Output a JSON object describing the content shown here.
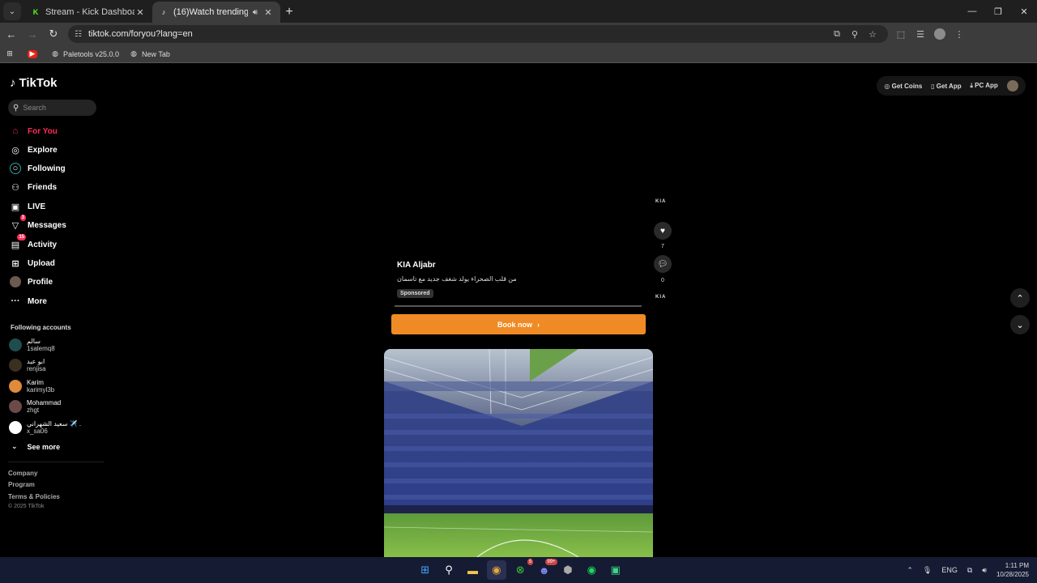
{
  "browser": {
    "tabs": [
      {
        "title": "Stream - Kick Dashboard",
        "favicon": "K",
        "favicon_color": "#53fc18",
        "active": false
      },
      {
        "title": "(16)Watch trending videos f",
        "favicon": "♪",
        "favicon_color": "#ffffff",
        "active": true
      }
    ],
    "url": "tiktok.com/foryou?lang=en",
    "bookmarks": [
      {
        "label": "",
        "icon": "youtube-icon"
      },
      {
        "label": "Paletools v25.0.0",
        "icon": "globe-icon"
      },
      {
        "label": "New Tab",
        "icon": "globe-icon"
      }
    ]
  },
  "tiktok": {
    "logo": "TikTok",
    "search_placeholder": "Search",
    "nav": [
      {
        "label": "For You",
        "icon": "home-icon",
        "glyph": "⌂",
        "active": true
      },
      {
        "label": "Explore",
        "icon": "compass-icon",
        "glyph": "◎"
      },
      {
        "label": "Following",
        "icon": "following-icon",
        "glyph": "○"
      },
      {
        "label": "Friends",
        "icon": "friends-icon",
        "glyph": "⚇"
      },
      {
        "label": "LIVE",
        "icon": "live-icon",
        "glyph": "▣"
      },
      {
        "label": "Messages",
        "icon": "messages-icon",
        "glyph": "▽",
        "badge": "3"
      },
      {
        "label": "Activity",
        "icon": "activity-icon",
        "glyph": "▤",
        "badge": "15"
      },
      {
        "label": "Upload",
        "icon": "upload-icon",
        "glyph": "⊞"
      },
      {
        "label": "Profile",
        "icon": "profile-icon",
        "glyph": ""
      },
      {
        "label": "More",
        "icon": "more-icon",
        "glyph": "···"
      }
    ],
    "following_title": "Following accounts",
    "accounts": [
      {
        "name": "سالم",
        "handle": "1salemq8",
        "color": "#1f4d4d"
      },
      {
        "name": "ابو عبد",
        "handle": "renjisa",
        "color": "#3a3020"
      },
      {
        "name": "Karim",
        "handle": "karimyl3b",
        "color": "#e08a3c"
      },
      {
        "name": "Mohammad",
        "handle": "zhgt",
        "color": "#6b4a4a"
      },
      {
        "name": "سعيد الشهراني ✈️ .",
        "handle": "x_sa06",
        "color": "#ffffff"
      }
    ],
    "see_more": "See more",
    "footer": [
      "Company",
      "Program",
      "Terms & Policies"
    ],
    "copyright": "© 2025 TikTok",
    "top_actions": {
      "coins": "Get Coins",
      "get_app": "Get App",
      "pc_app": "PC App"
    },
    "ad": {
      "advertiser": "KIA Aljabr",
      "description": "من قلب الصحراء يولد شغف جديد مع تاسمان",
      "sponsored": "Sponsored",
      "cta": "Book now",
      "likes": "7",
      "comments": "0",
      "partial_label": "KIA"
    }
  },
  "taskbar": {
    "icons": [
      "windows-icon",
      "search-icon",
      "file-explorer-icon",
      "chrome-icon",
      "xbox-icon",
      "discord-icon",
      "app-icon",
      "spotify-icon",
      "game-icon"
    ],
    "badges": {
      "xbox": "5",
      "discord": "99+"
    },
    "language": "ENG",
    "time": "1:11 PM",
    "date": "10/28/2025"
  }
}
